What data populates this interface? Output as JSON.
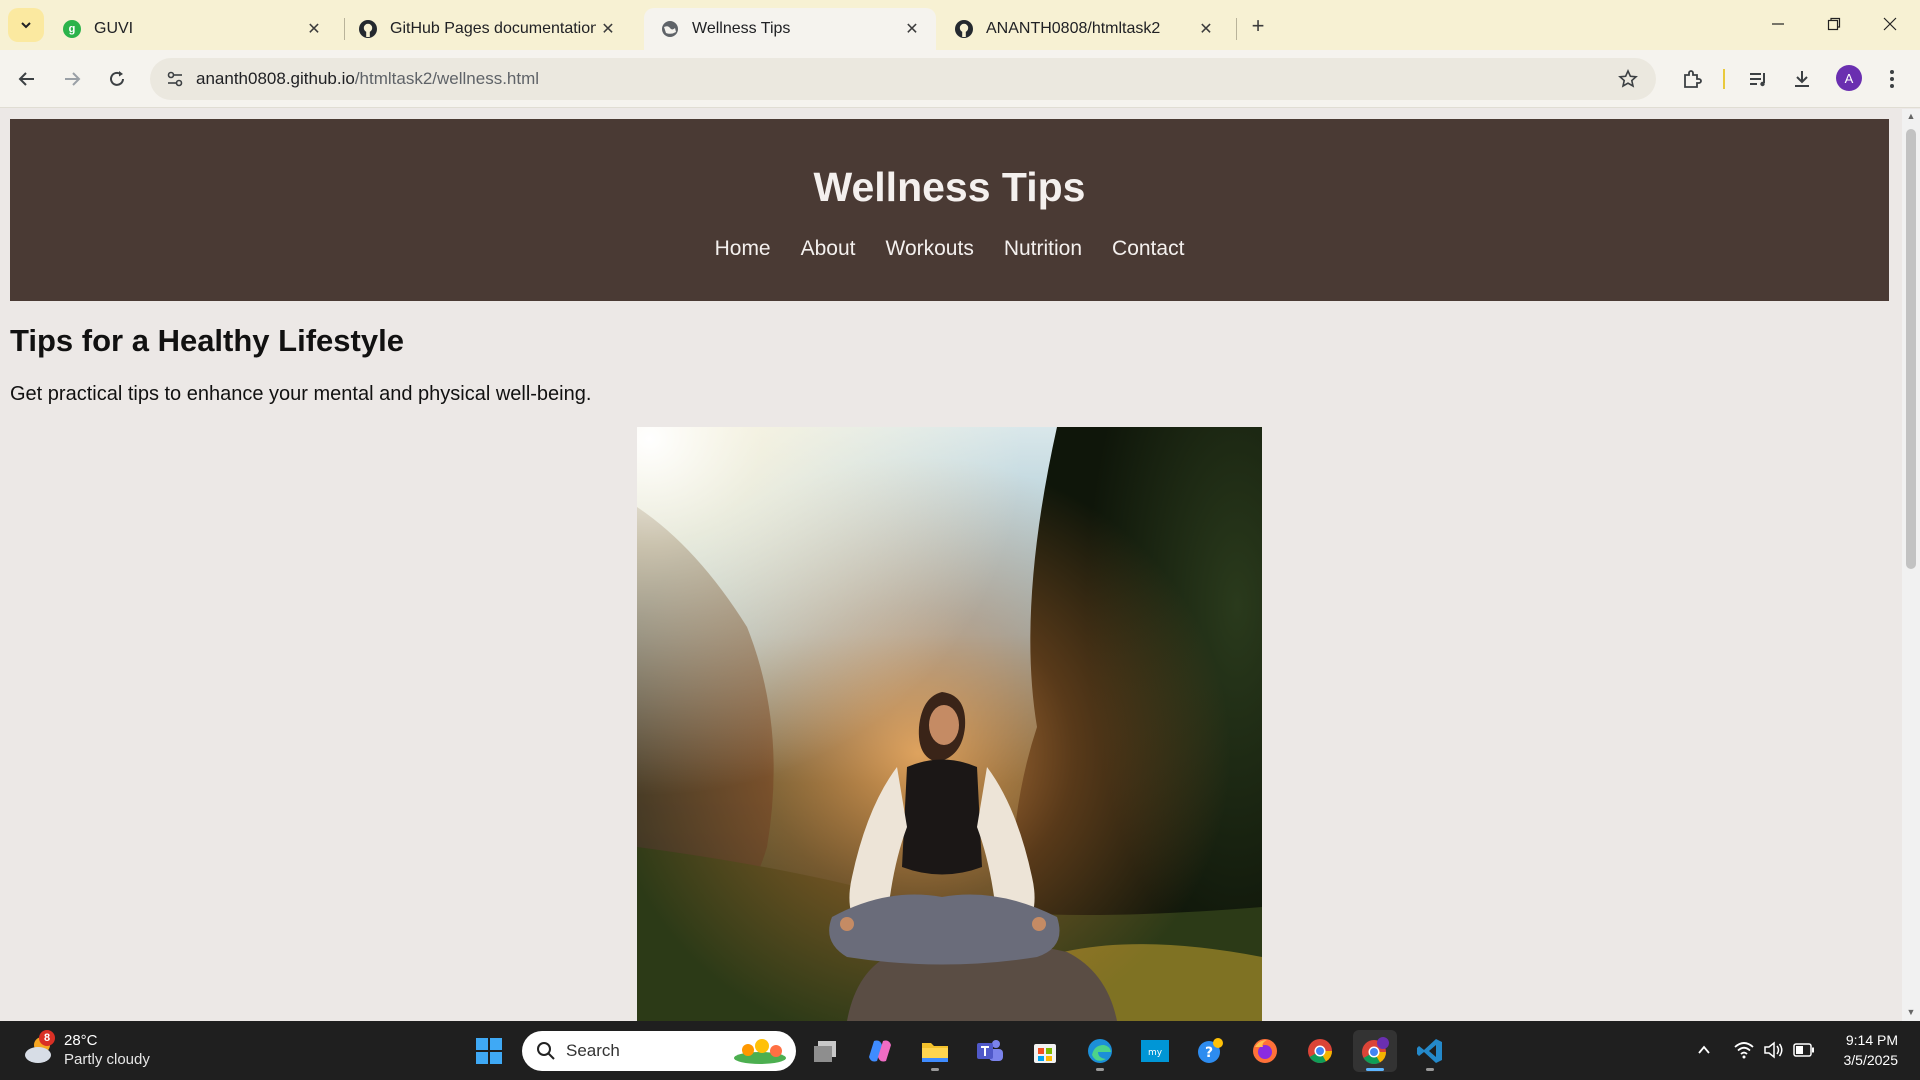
{
  "browser": {
    "tabs": [
      {
        "label": "GUVI",
        "active": false
      },
      {
        "label": "GitHub Pages documentation - GitHub Docs",
        "active": false
      },
      {
        "label": "Wellness Tips",
        "active": true
      },
      {
        "label": "ANANTH0808/htmltask2",
        "active": false
      }
    ],
    "url_host": "ananth0808.github.io",
    "url_path": "/htmltask2/wellness.html",
    "profile_initial": "A",
    "guvi_favicon_letter": "g"
  },
  "page": {
    "site_title": "Wellness Tips",
    "nav": [
      "Home",
      "About",
      "Workouts",
      "Nutrition",
      "Contact"
    ],
    "heading": "Tips for a Healthy Lifestyle",
    "intro": "Get practical tips to enhance your mental and physical well-being."
  },
  "taskbar": {
    "weather_temp": "28°C",
    "weather_cond": "Partly cloudy",
    "weather_badge": "8",
    "search_placeholder": "Search",
    "time": "9:14 PM",
    "date": "3/5/2025"
  },
  "colors": {
    "header_bg": "#4a3a34",
    "page_bg": "#ece8e6",
    "tabstrip_bg": "#f7f1d3"
  }
}
